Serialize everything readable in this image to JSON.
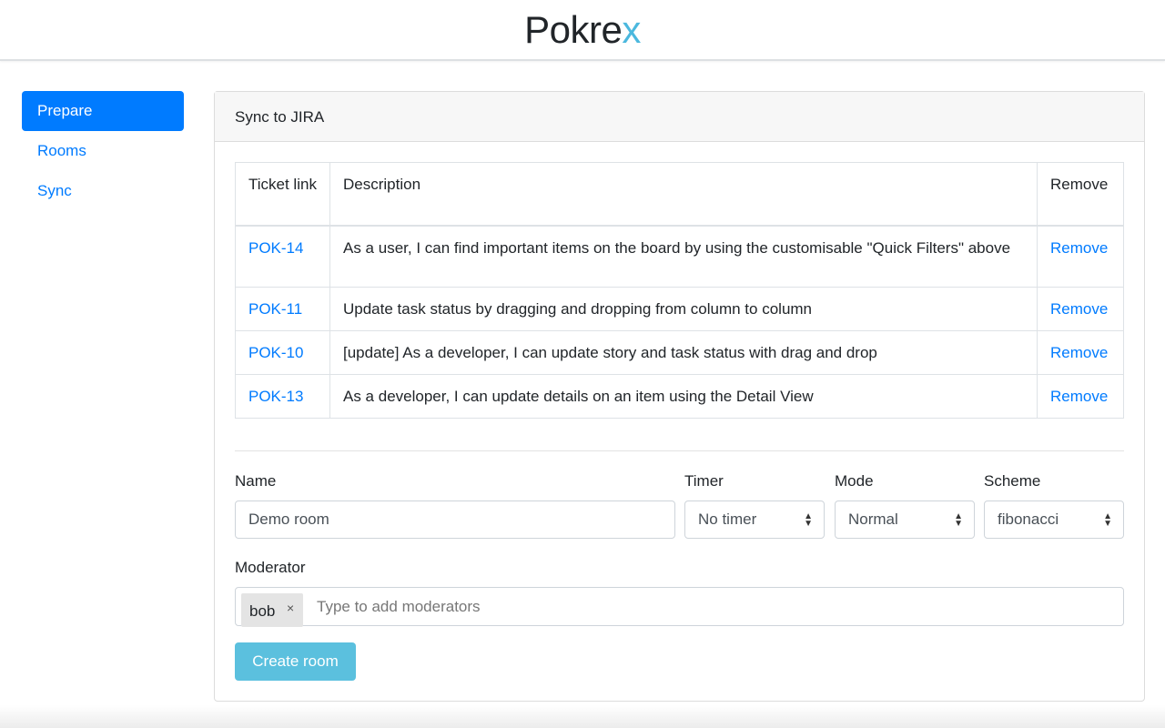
{
  "app": {
    "logo_main": "Pokre",
    "logo_accent": "x"
  },
  "sidebar": {
    "items": [
      {
        "label": "Prepare"
      },
      {
        "label": "Rooms"
      },
      {
        "label": "Sync"
      }
    ]
  },
  "card": {
    "title": "Sync to JIRA"
  },
  "table": {
    "headers": [
      "Ticket link",
      "Description",
      "Remove"
    ],
    "rows": [
      {
        "ticket": "POK-14",
        "description": "As a user, I can find important items on the board by using the customisable \"Quick Filters\" above",
        "action": "Remove"
      },
      {
        "ticket": "POK-11",
        "description": "Update task status by dragging and dropping from column to column",
        "action": "Remove"
      },
      {
        "ticket": "POK-10",
        "description": "[update] As a developer, I can update story and task status with drag and drop",
        "action": "Remove"
      },
      {
        "ticket": "POK-13",
        "description": "As a developer, I can update details on an item using the Detail View",
        "action": "Remove"
      }
    ]
  },
  "form": {
    "name_label": "Name",
    "name_value": "Demo room",
    "timer_label": "Timer",
    "timer_value": "No timer",
    "mode_label": "Mode",
    "mode_value": "Normal",
    "scheme_label": "Scheme",
    "scheme_value": "fibonacci",
    "moderator_label": "Moderator",
    "moderator_tag": "bob",
    "moderator_tag_remove": "×",
    "moderator_placeholder": "Type to add moderators",
    "submit_label": "Create room"
  },
  "colors": {
    "primary": "#007bff",
    "accent": "#4bb8de",
    "button": "#5bc0de"
  }
}
